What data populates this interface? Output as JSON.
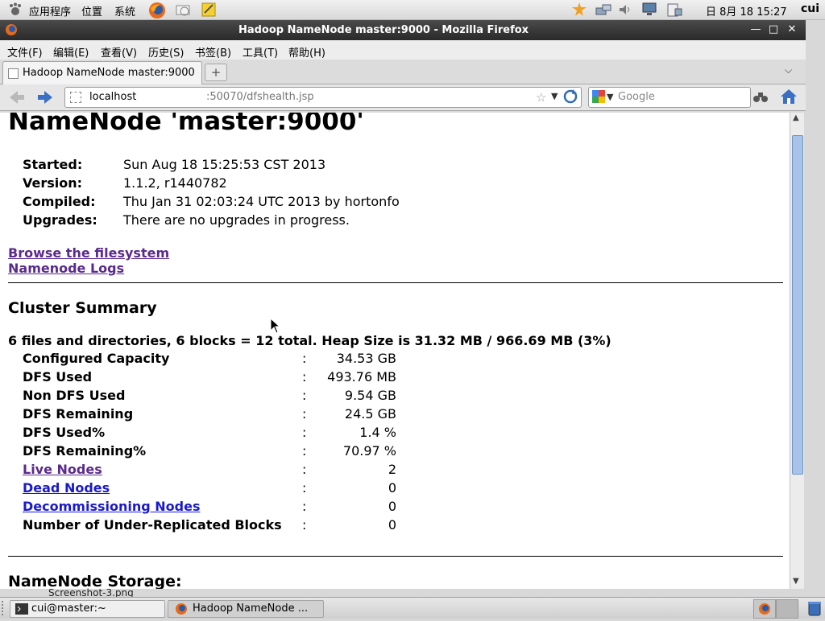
{
  "top_panel": {
    "menus": [
      "应用程序",
      "位置",
      "系统"
    ],
    "clock": "日 8月 18 15:27",
    "user": "cui"
  },
  "window": {
    "title": "Hadoop NameNode master:9000 - Mozilla Firefox"
  },
  "menubar": [
    "文件(F)",
    "编辑(E)",
    "查看(V)",
    "历史(S)",
    "书签(B)",
    "工具(T)",
    "帮助(H)"
  ],
  "tab": {
    "label": "Hadoop NameNode master:9000"
  },
  "urlbar": {
    "host": "localhost",
    "path": ":50070/dfshealth.jsp"
  },
  "search": {
    "placeholder": "Google"
  },
  "page": {
    "title": "NameNode 'master:9000'",
    "info": [
      {
        "label": "Started:",
        "value": "Sun Aug 18 15:25:53 CST 2013"
      },
      {
        "label": "Version:",
        "value": "1.1.2, r1440782"
      },
      {
        "label": "Compiled:",
        "value": "Thu Jan 31 02:03:24 UTC 2013 by hortonfo"
      },
      {
        "label": "Upgrades:",
        "value": "There are no upgrades in progress."
      }
    ],
    "links": [
      "Browse the filesystem",
      "Namenode Logs"
    ],
    "cluster_heading": "Cluster Summary",
    "cluster_totals": "6 files and directories, 6 blocks = 12 total. Heap Size is 31.32 MB / 966.69 MB (3%)",
    "colon": ":",
    "cluster_rows": [
      {
        "label": "Configured Capacity",
        "value": "34.53 GB"
      },
      {
        "label": "DFS Used",
        "value": "493.76 MB"
      },
      {
        "label": "Non DFS Used",
        "value": "9.54 GB"
      },
      {
        "label": "DFS Remaining",
        "value": "24.5 GB"
      },
      {
        "label": "DFS Used%",
        "value": "1.4 %"
      },
      {
        "label": "DFS Remaining%",
        "value": "70.97 %"
      },
      {
        "label": "Live Nodes",
        "value": "2"
      },
      {
        "label": "Dead Nodes",
        "value": "0"
      },
      {
        "label": "Decommissioning Nodes",
        "value": "0"
      },
      {
        "label": "Number of Under-Replicated Blocks",
        "value": "0"
      }
    ],
    "storage_heading": "NameNode Storage:"
  },
  "desktop": {
    "file_label": "Screenshot-3.png"
  },
  "taskbar": {
    "items": [
      "cui@master:~",
      "Hadoop NameNode ..."
    ]
  }
}
